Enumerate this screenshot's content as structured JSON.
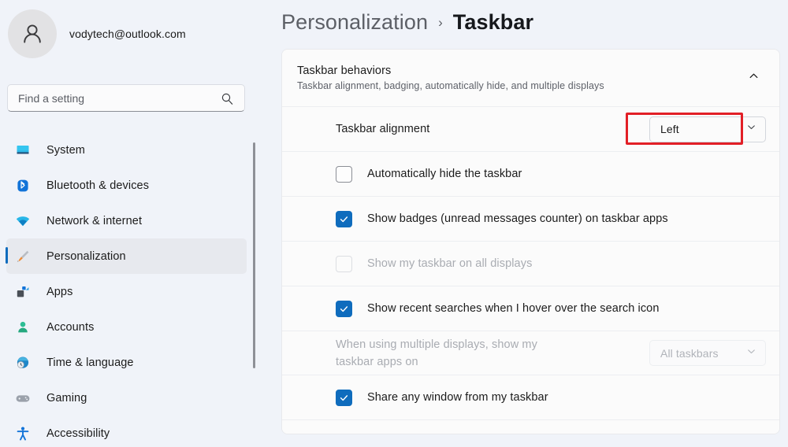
{
  "account": {
    "email": "vodytech@outlook.com",
    "avatar_icon": "user-avatar-icon"
  },
  "search": {
    "placeholder": "Find a setting",
    "value": "",
    "icon": "search-icon"
  },
  "sidebar": {
    "items": [
      {
        "label": "System",
        "icon": "monitor-icon",
        "selected": false
      },
      {
        "label": "Bluetooth & devices",
        "icon": "bluetooth-icon",
        "selected": false
      },
      {
        "label": "Network & internet",
        "icon": "wifi-icon",
        "selected": false
      },
      {
        "label": "Personalization",
        "icon": "paintbrush-icon",
        "selected": true
      },
      {
        "label": "Apps",
        "icon": "apps-icon",
        "selected": false
      },
      {
        "label": "Accounts",
        "icon": "person-icon",
        "selected": false
      },
      {
        "label": "Time & language",
        "icon": "clock-globe-icon",
        "selected": false
      },
      {
        "label": "Gaming",
        "icon": "gamepad-icon",
        "selected": false
      },
      {
        "label": "Accessibility",
        "icon": "accessibility-icon",
        "selected": false
      }
    ]
  },
  "breadcrumb": {
    "parent": "Personalization",
    "separator": "›",
    "current": "Taskbar"
  },
  "card": {
    "title": "Taskbar behaviors",
    "subtitle": "Taskbar alignment, badging, automatically hide, and multiple displays",
    "collapse_icon": "chevron-up-icon",
    "expanded": true,
    "rows": {
      "alignment": {
        "label": "Taskbar alignment",
        "value": "Left",
        "chevron_icon": "chevron-down-icon",
        "highlighted": true,
        "highlight_color": "#e21f26"
      },
      "auto_hide": {
        "label": "Automatically hide the taskbar",
        "checked": false,
        "disabled": false
      },
      "badges": {
        "label": "Show badges (unread messages counter) on taskbar apps",
        "checked": true,
        "disabled": false
      },
      "all_displays": {
        "label": "Show my taskbar on all displays",
        "checked": false,
        "disabled": true
      },
      "recent_searches": {
        "label": "Show recent searches when I hover over the search icon",
        "checked": true,
        "disabled": false
      },
      "multi_display": {
        "label": "When using multiple displays, show my taskbar apps on",
        "value": "All taskbars",
        "chevron_icon": "chevron-down-icon",
        "disabled": true
      },
      "share_window": {
        "label": "Share any window from my taskbar",
        "checked": true,
        "disabled": false
      }
    }
  },
  "colors": {
    "accent": "#0f6cbd",
    "page_background": "#f0f3f9",
    "card_background": "#fbfbfb",
    "annotation_red": "#e21f26"
  }
}
